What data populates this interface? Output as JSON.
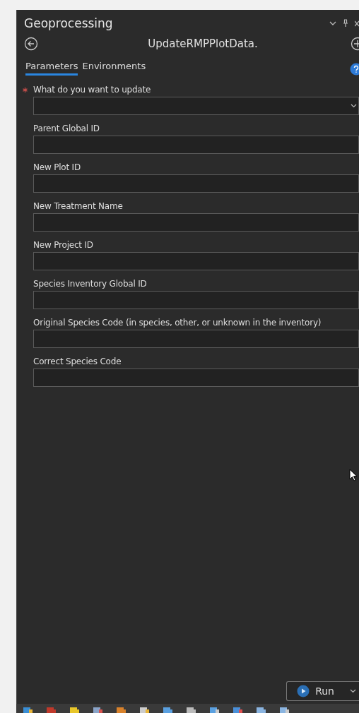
{
  "panel": {
    "title": "Geoprocessing",
    "tool_name": "UpdateRMPPlotData."
  },
  "tabs": [
    {
      "label": "Parameters",
      "selected": true
    },
    {
      "label": "Environments",
      "selected": false
    }
  ],
  "parameters": [
    {
      "label": "What do you want to update",
      "required": true,
      "kind": "dropdown"
    },
    {
      "label": "Parent Global ID",
      "required": false,
      "kind": "text"
    },
    {
      "label": "New Plot ID",
      "required": false,
      "kind": "text"
    },
    {
      "label": "New Treatment Name",
      "required": false,
      "kind": "text"
    },
    {
      "label": "New Project ID",
      "required": false,
      "kind": "text"
    },
    {
      "label": "Species Inventory Global ID",
      "required": false,
      "kind": "text"
    },
    {
      "label": "Original Species Code (in species, other, or unknown in the inventory)",
      "required": false,
      "kind": "text"
    },
    {
      "label": "Correct Species Code",
      "required": false,
      "kind": "text"
    }
  ],
  "run_button": {
    "label": "Run"
  }
}
